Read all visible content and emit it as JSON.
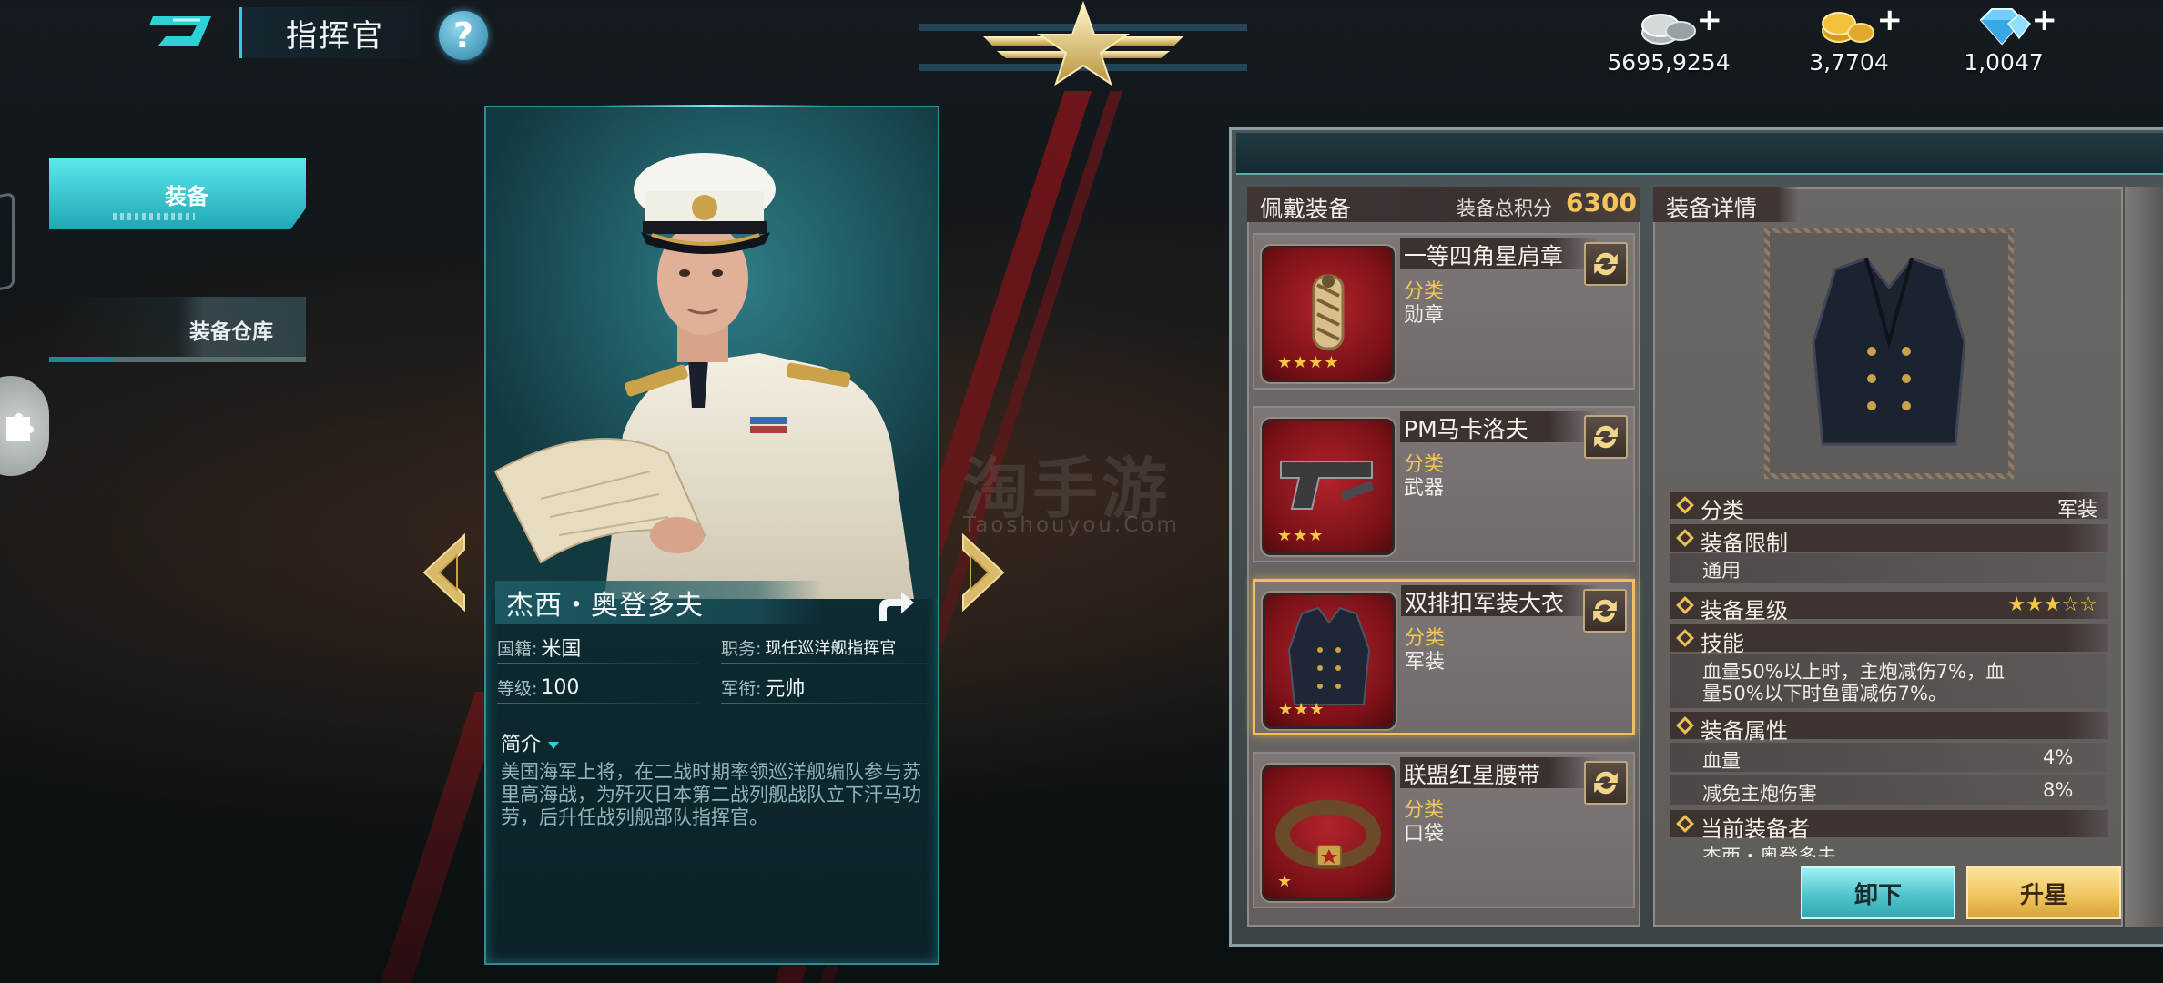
{
  "header": {
    "title": "指挥官",
    "help_label": "?"
  },
  "resources": [
    {
      "icon": "silver-coins-icon",
      "value": "5695,9254"
    },
    {
      "icon": "gold-coins-icon",
      "value": "3,7704"
    },
    {
      "icon": "diamond-icon",
      "value": "1,0047"
    }
  ],
  "plus_label": "+",
  "tabs": {
    "equip": "装备",
    "warehouse": "装备仓库"
  },
  "commander": {
    "name": "杰西・奥登多夫",
    "nationality_label": "国籍:",
    "nationality": "米国",
    "position_label": "职务:",
    "position": "现任巡洋舰指挥官",
    "level_label": "等级:",
    "level": "100",
    "rank_label": "军衔:",
    "rank": "元帅",
    "intro_title": "简介",
    "intro": "美国海军上将，在二战时期率领巡洋舰编队参与苏里高海战，为歼灭日本第二战列舰战队立下汗马功劳，后升任战列舰部队指挥官。"
  },
  "watermark": {
    "cn": "淘手游",
    "en": "Taoshouyou.Com"
  },
  "equip_panel": {
    "title": "佩戴装备",
    "score_label": "装备总积分",
    "score": "6300",
    "category_label": "分类",
    "items": [
      {
        "name": "一等四角星肩章",
        "category": "勋章",
        "stars": "★★★★",
        "icon": "epaulette-icon"
      },
      {
        "name": "PM马卡洛夫",
        "category": "武器",
        "stars": "★★★",
        "icon": "pistol-icon"
      },
      {
        "name": "双排扣军装大衣",
        "category": "军装",
        "stars": "★★★",
        "icon": "coat-icon"
      },
      {
        "name": "联盟红星腰带",
        "category": "口袋",
        "stars": "★",
        "icon": "belt-icon"
      }
    ]
  },
  "detail_panel": {
    "title": "装备详情",
    "category_label": "分类",
    "category": "军装",
    "restriction_label": "装备限制",
    "restriction": "通用",
    "star_label": "装备星级",
    "star_value": "★★★☆☆",
    "skill_label": "技能",
    "skill_line1": "血量50%以上时，主炮减伤7%，血",
    "skill_line2": "量50%以下时鱼雷减伤7%。",
    "attr_label": "装备属性",
    "attrs": [
      {
        "name": "血量",
        "value": "4%"
      },
      {
        "name": "减免主炮伤害",
        "value": "8%"
      }
    ],
    "wearer_label": "当前装备者",
    "wearer": "杰西・奥登多夫"
  },
  "buttons": {
    "unequip": "卸下",
    "upstar": "升星"
  },
  "colors": {
    "accent_cyan": "#2ed0d6",
    "gold": "#f3c657",
    "item_red": "#b2232b"
  }
}
